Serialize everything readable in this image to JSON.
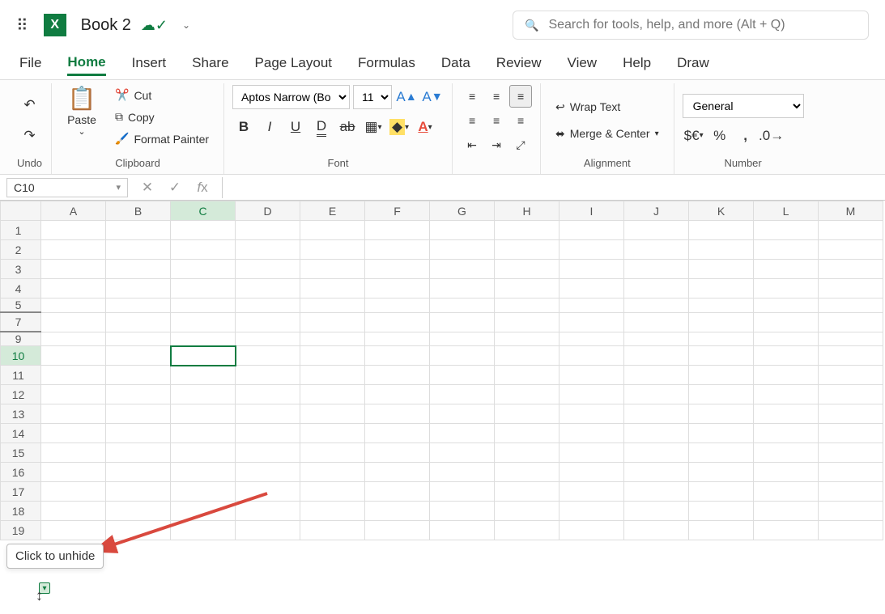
{
  "title": {
    "docname": "Book 2"
  },
  "search": {
    "placeholder": "Search for tools, help, and more (Alt + Q)"
  },
  "tabs": [
    "File",
    "Home",
    "Insert",
    "Share",
    "Page Layout",
    "Formulas",
    "Data",
    "Review",
    "View",
    "Help",
    "Draw"
  ],
  "active_tab": "Home",
  "ribbon": {
    "undo_label": "Undo",
    "paste_label": "Paste",
    "cut_label": "Cut",
    "copy_label": "Copy",
    "format_painter_label": "Format Painter",
    "clipboard_label": "Clipboard",
    "font_name": "Aptos Narrow (Bo…",
    "font_size": "11",
    "font_label": "Font",
    "wrap_label": "Wrap Text",
    "merge_label": "Merge & Center",
    "alignment_label": "Alignment",
    "number_format": "General",
    "currency_glyph": "$€",
    "percent_glyph": "%",
    "comma_glyph": ",",
    "number_label": "Number"
  },
  "formula_bar": {
    "namebox": "C10",
    "formula": ""
  },
  "columns": [
    "A",
    "B",
    "C",
    "D",
    "E",
    "F",
    "G",
    "H",
    "I",
    "J",
    "K",
    "L",
    "M"
  ],
  "rows_visible": [
    "1",
    "2",
    "3",
    "4",
    "5",
    "7",
    "9",
    "10",
    "11",
    "12",
    "13",
    "14",
    "15",
    "16",
    "17",
    "18",
    "19"
  ],
  "selected_col": "C",
  "selected_row": "10",
  "tooltip_text": "Click to unhide"
}
